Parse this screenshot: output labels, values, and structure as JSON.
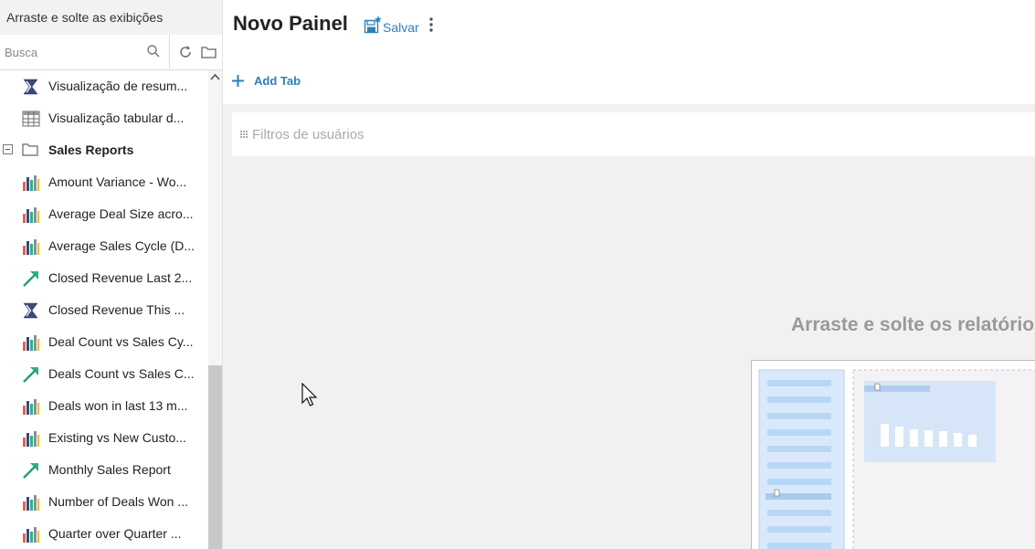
{
  "sidebar": {
    "header": "Arraste e solte as exibições",
    "search_placeholder": "Busca",
    "items": [
      {
        "label": "Visualização de resum...",
        "icon": "sigma-icon"
      },
      {
        "label": "Visualização tabular d...",
        "icon": "table-icon"
      },
      {
        "label": "Sales Reports",
        "icon": "folder-icon",
        "group": true
      },
      {
        "label": "Amount Variance - Wo...",
        "icon": "bar-chart-icon"
      },
      {
        "label": "Average Deal Size acro...",
        "icon": "bar-chart-icon"
      },
      {
        "label": "Average Sales Cycle (D...",
        "icon": "bar-chart-icon"
      },
      {
        "label": "Closed Revenue Last 2...",
        "icon": "trend-arrow-icon"
      },
      {
        "label": "Closed Revenue This ...",
        "icon": "sigma-icon"
      },
      {
        "label": "Deal Count vs Sales Cy...",
        "icon": "bar-chart-icon"
      },
      {
        "label": "Deals Count vs Sales C...",
        "icon": "trend-arrow-icon"
      },
      {
        "label": "Deals won in last 13 m...",
        "icon": "bar-chart-icon"
      },
      {
        "label": "Existing vs New Custo...",
        "icon": "bar-chart-icon"
      },
      {
        "label": "Monthly Sales Report",
        "icon": "trend-arrow-icon"
      },
      {
        "label": "Number of Deals Won ...",
        "icon": "bar-chart-icon"
      },
      {
        "label": "Quarter over Quarter ...",
        "icon": "bar-chart-icon"
      }
    ]
  },
  "main": {
    "title": "Novo Painel",
    "save_label": "Salvar",
    "add_tab_label": "Add Tab",
    "filter_placeholder": "Filtros de usuários",
    "drop_hint": "Arraste e solte os relatórios"
  },
  "colors": {
    "accent": "#2e7fb7",
    "background": "#f1f1f1",
    "icon_green": "#2eaf8a",
    "icon_navy": "#3c4a7a"
  }
}
